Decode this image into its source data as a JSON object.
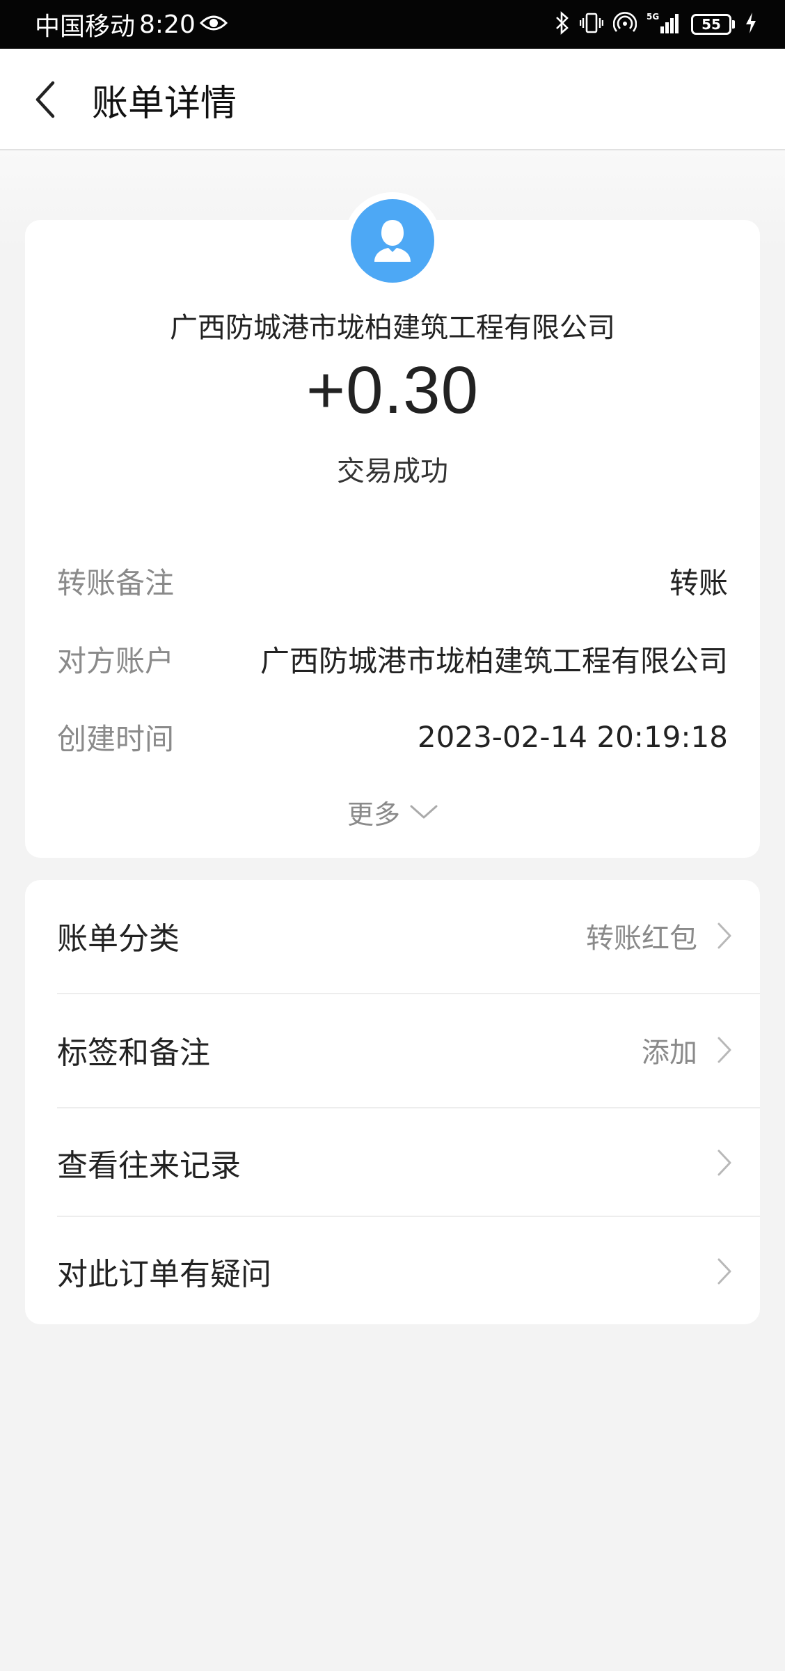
{
  "status_bar": {
    "carrier": "中国移动",
    "time": "8:20",
    "battery": "55",
    "network": "5G"
  },
  "nav": {
    "title": "账单详情"
  },
  "summary": {
    "counterparty": "广西防城港市垅柏建筑工程有限公司",
    "amount": "+0.30",
    "status": "交易成功"
  },
  "details": [
    {
      "label": "转账备注",
      "value": "转账"
    },
    {
      "label": "对方账户",
      "value": "广西防城港市垅柏建筑工程有限公司"
    },
    {
      "label": "创建时间",
      "value": "2023-02-14 20:19:18"
    }
  ],
  "more_label": "更多",
  "actions": [
    {
      "label": "账单分类",
      "value": "转账红包"
    },
    {
      "label": "标签和备注",
      "value": "添加"
    },
    {
      "label": "查看往来记录",
      "value": ""
    },
    {
      "label": "对此订单有疑问",
      "value": ""
    }
  ],
  "colors": {
    "avatar": "#4da8f5",
    "background": "#f3f3f3",
    "card": "#ffffff",
    "secondary_text": "#8a8a8a"
  }
}
